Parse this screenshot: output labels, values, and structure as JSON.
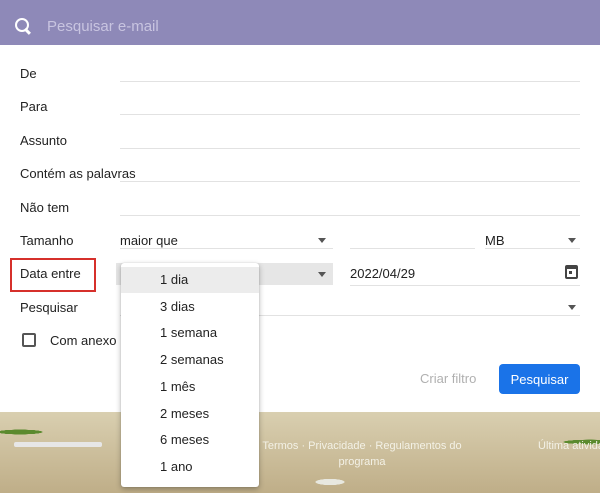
{
  "search": {
    "placeholder": "Pesquisar e-mail"
  },
  "form": {
    "from_label": "De",
    "to_label": "Para",
    "subject_label": "Assunto",
    "has_words_label": "Contém as palavras",
    "not_have_label": "Não tem",
    "size_label": "Tamanho",
    "size_operator": "maior que",
    "size_unit": "MB",
    "date_label": "Data entre",
    "date_value": "2022/04/29",
    "search_in_label": "Pesquisar",
    "attachment_label": "Com anexo",
    "create_filter_label": "Criar filtro",
    "search_button_label": "Pesquisar"
  },
  "date_menu": {
    "selected_index": 0,
    "items": [
      "1 dia",
      "3 dias",
      "1 semana",
      "2 semanas",
      "1 mês",
      "2 meses",
      "6 meses",
      "1 ano"
    ]
  },
  "footer": {
    "links": "Termos · Privacidade · Regulamentos do programa",
    "activity": "Última atividade"
  },
  "colors": {
    "header": "#8e89b8",
    "primary": "#1a73e8",
    "highlight": "#d6302b"
  }
}
